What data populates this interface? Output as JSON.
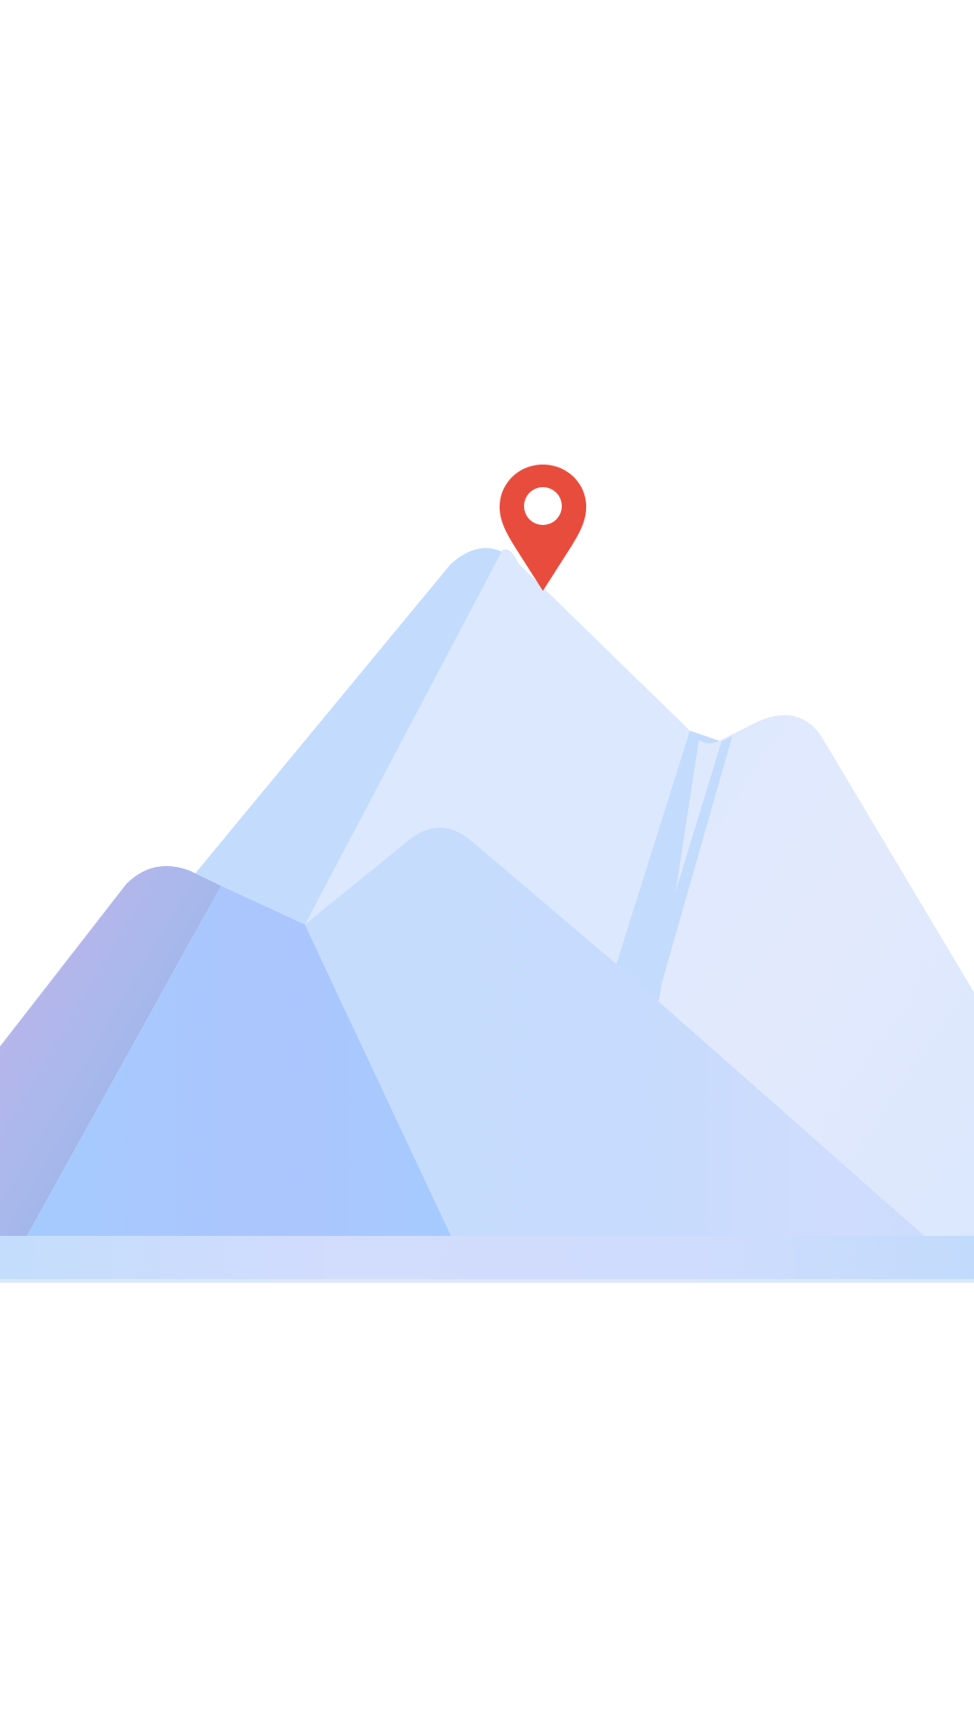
{
  "screen": {
    "background_color": "#ffffff"
  },
  "illustration": {
    "subject": "mountain-range-with-location-pin",
    "pin_icon": "map-pin-icon",
    "colors": {
      "pin": "#e84c3d",
      "pin_hole": "#ffffff",
      "mountain_light": "#dbe8fd",
      "mountain_mid": "#c4dbfd",
      "mountain_shadow": "#a6cbfe",
      "mountain_purple": "#c2b5ea",
      "ground": "#c4dcfb"
    }
  }
}
